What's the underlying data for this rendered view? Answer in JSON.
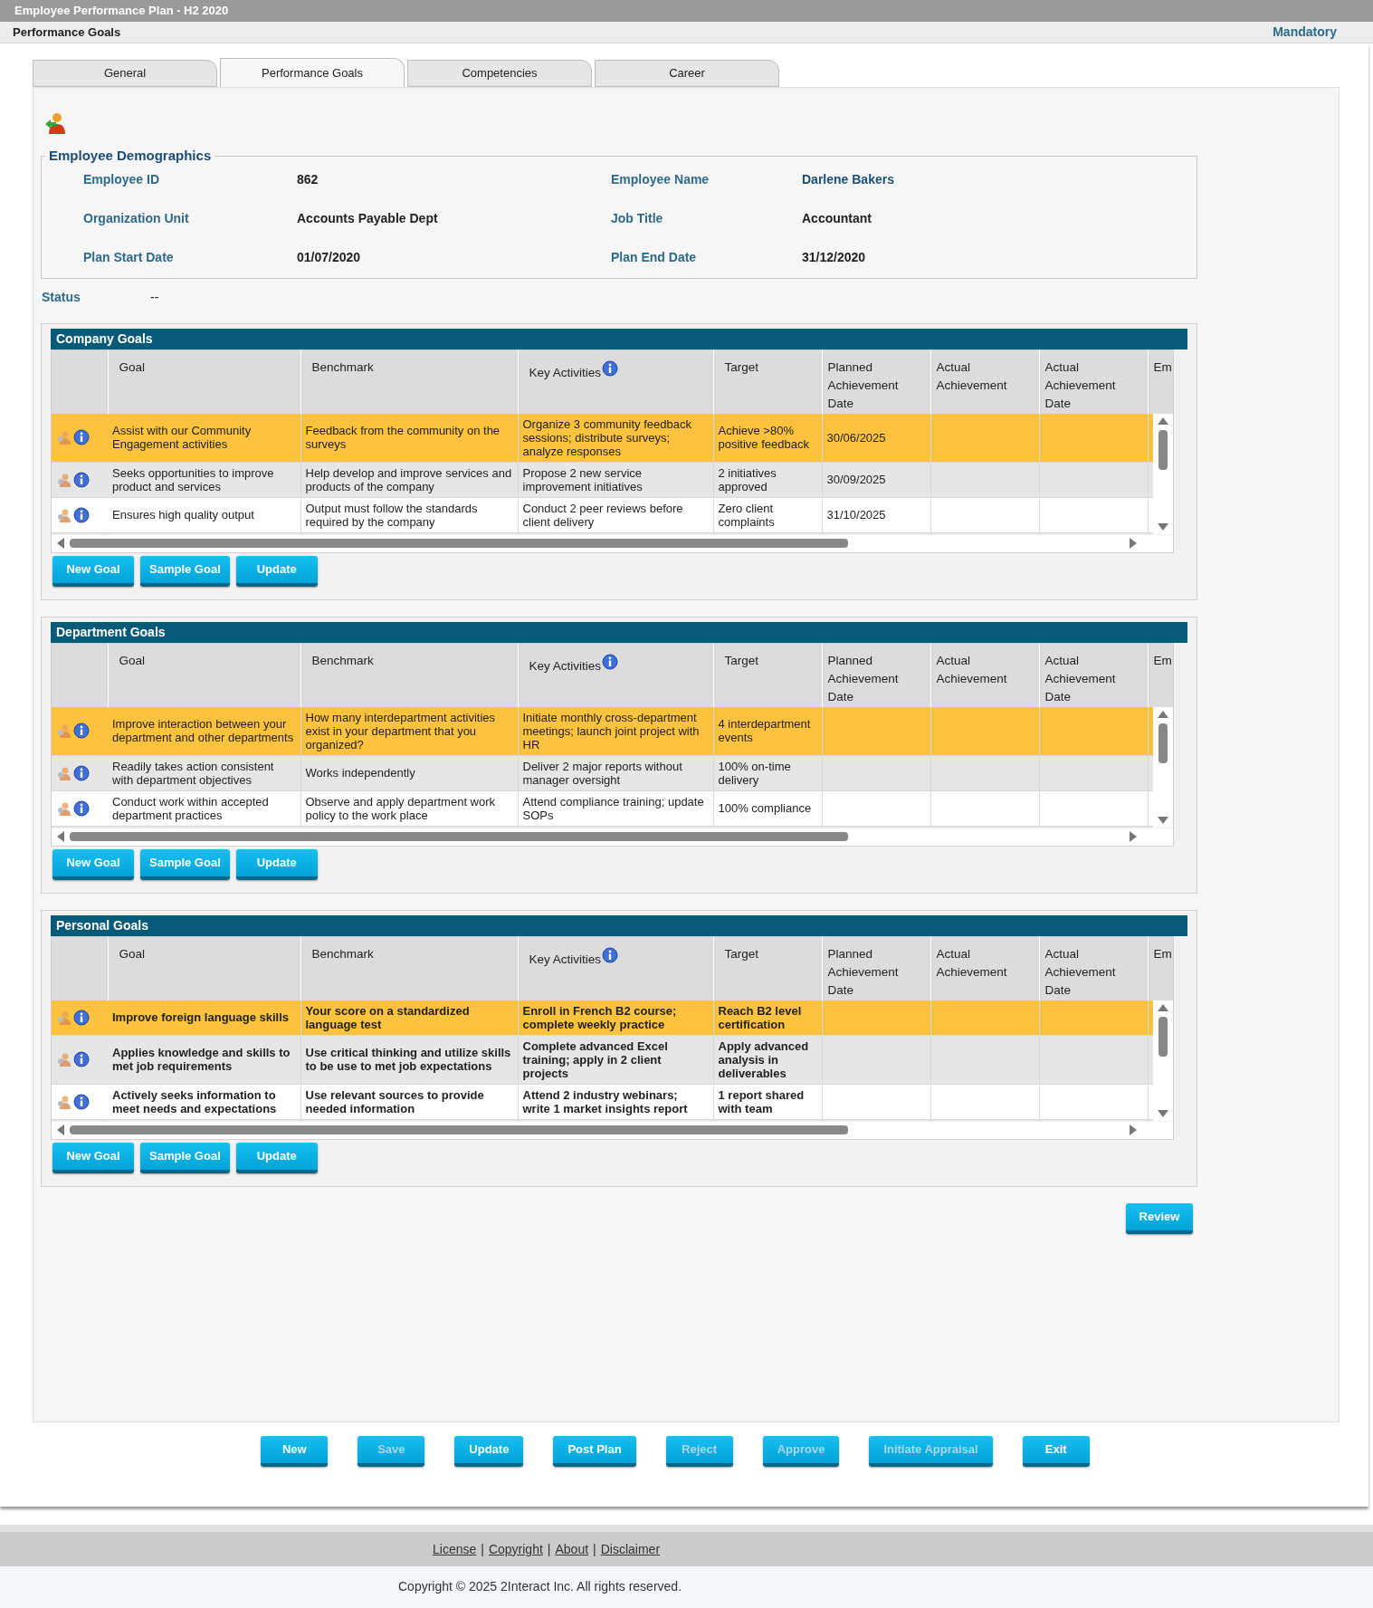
{
  "window": {
    "title": "Employee Performance Plan - H2 2020"
  },
  "page_header": {
    "title": "Performance Goals",
    "badge": "Mandatory"
  },
  "tabs": [
    {
      "label": "General",
      "selected": false
    },
    {
      "label": "Performance Goals",
      "selected": true
    },
    {
      "label": "Competencies",
      "selected": false
    },
    {
      "label": "Career",
      "selected": false
    }
  ],
  "demographics": {
    "legend": "Employee Demographics",
    "fields": [
      {
        "label": "Employee ID",
        "value": "862",
        "highlight": false
      },
      {
        "label": "Employee Name",
        "value": "Darlene Bakers",
        "highlight": true
      },
      {
        "label": "Organization Unit",
        "value": "Accounts Payable Dept",
        "highlight": false
      },
      {
        "label": "Job Title",
        "value": "Accountant",
        "highlight": false
      },
      {
        "label": "Plan Start Date",
        "value": "01/07/2020",
        "highlight": false
      },
      {
        "label": "Plan End Date",
        "value": "31/12/2020",
        "highlight": false
      }
    ]
  },
  "status": {
    "label": "Status",
    "value": "--"
  },
  "sections": [
    {
      "title": "Company Goals",
      "bold_rows": false,
      "columns": [
        "Goal",
        "Benchmark",
        "Key Activities",
        "Target",
        "Planned Achievement Date",
        "Actual Achievement",
        "Actual Achievement Date",
        "Em"
      ],
      "rows": [
        {
          "selected": true,
          "cells": [
            "Assist with our Community Engagement activities",
            "Feedback from the community on the surveys",
            "Organize 3 community feedback sessions; distribute surveys; analyze responses",
            "Achieve >80% positive feedback",
            "30/06/2025"
          ]
        },
        {
          "selected": false,
          "cells": [
            "Seeks opportunities to improve product and services",
            "Help develop and improve services and products of the company",
            "Propose 2 new service improvement initiatives",
            "2 initiatives approved",
            "30/09/2025"
          ]
        },
        {
          "selected": false,
          "cells": [
            "Ensures high quality output",
            "Output must follow the standards required by the company",
            "Conduct 2 peer reviews before client delivery",
            "Zero client complaints",
            "31/10/2025"
          ]
        }
      ],
      "buttons": [
        "New Goal",
        "Sample Goal",
        "Update"
      ]
    },
    {
      "title": "Department Goals",
      "bold_rows": false,
      "columns": [
        "Goal",
        "Benchmark",
        "Key Activities",
        "Target",
        "Planned Achievement Date",
        "Actual Achievement",
        "Actual Achievement Date",
        "Em"
      ],
      "rows": [
        {
          "selected": true,
          "cells": [
            "Improve interaction between your department and other departments",
            "How many interdepartment activities exist in your department that you organized?",
            "Initiate monthly cross-department meetings; launch joint project with HR",
            "4 interdepartment events",
            ""
          ]
        },
        {
          "selected": false,
          "cells": [
            "Readily takes action consistent with department objectives",
            "Works independently",
            "Deliver 2 major reports without manager oversight",
            "100% on-time delivery",
            ""
          ]
        },
        {
          "selected": false,
          "cells": [
            "Conduct work within accepted department practices",
            "Observe and apply department work policy to the work place",
            "Attend compliance training; update SOPs",
            "100% compliance",
            ""
          ]
        }
      ],
      "buttons": [
        "New Goal",
        "Sample Goal",
        "Update"
      ]
    },
    {
      "title": "Personal Goals",
      "bold_rows": true,
      "columns": [
        "Goal",
        "Benchmark",
        "Key Activities",
        "Target",
        "Planned Achievement Date",
        "Actual Achievement",
        "Actual Achievement Date",
        "Em"
      ],
      "rows": [
        {
          "selected": true,
          "cells": [
            "Improve foreign language skills",
            "Your score on a standardized language test",
            "Enroll in French B2 course; complete weekly practice",
            "Reach B2 level certification",
            ""
          ]
        },
        {
          "selected": false,
          "cells": [
            "Applies knowledge and skills to met job requirements",
            "Use critical thinking and utilize skills to be use to met job expectations",
            "Complete advanced Excel training; apply in 2 client projects",
            "Apply advanced analysis in deliverables",
            ""
          ]
        },
        {
          "selected": false,
          "cells": [
            "Actively seeks information to meet needs and expectations",
            "Use relevant sources to provide needed information",
            "Attend 2 industry webinars; write 1 market insights report",
            "1 report shared with team",
            ""
          ]
        }
      ],
      "buttons": [
        "New Goal",
        "Sample Goal",
        "Update"
      ]
    }
  ],
  "review_button": "Review",
  "action_buttons": [
    {
      "label": "New",
      "disabled": false
    },
    {
      "label": "Save",
      "disabled": true
    },
    {
      "label": "Update",
      "disabled": false
    },
    {
      "label": "Post Plan",
      "disabled": false
    },
    {
      "label": "Reject",
      "disabled": true
    },
    {
      "label": "Approve",
      "disabled": true
    },
    {
      "label": "Initiate Appraisal",
      "disabled": true
    },
    {
      "label": "Exit",
      "disabled": false
    }
  ],
  "footer": {
    "links": [
      {
        "kind": "link",
        "text": "License"
      },
      {
        "kind": "separator",
        "text": "|"
      },
      {
        "kind": "link",
        "text": "Copyright"
      },
      {
        "kind": "separator",
        "text": "|"
      },
      {
        "kind": "link",
        "text": "About"
      },
      {
        "kind": "separator",
        "text": "|"
      },
      {
        "kind": "link",
        "text": "Disclaimer"
      }
    ],
    "copyright": "Copyright © 2025 2Interact Inc. All rights reserved."
  }
}
